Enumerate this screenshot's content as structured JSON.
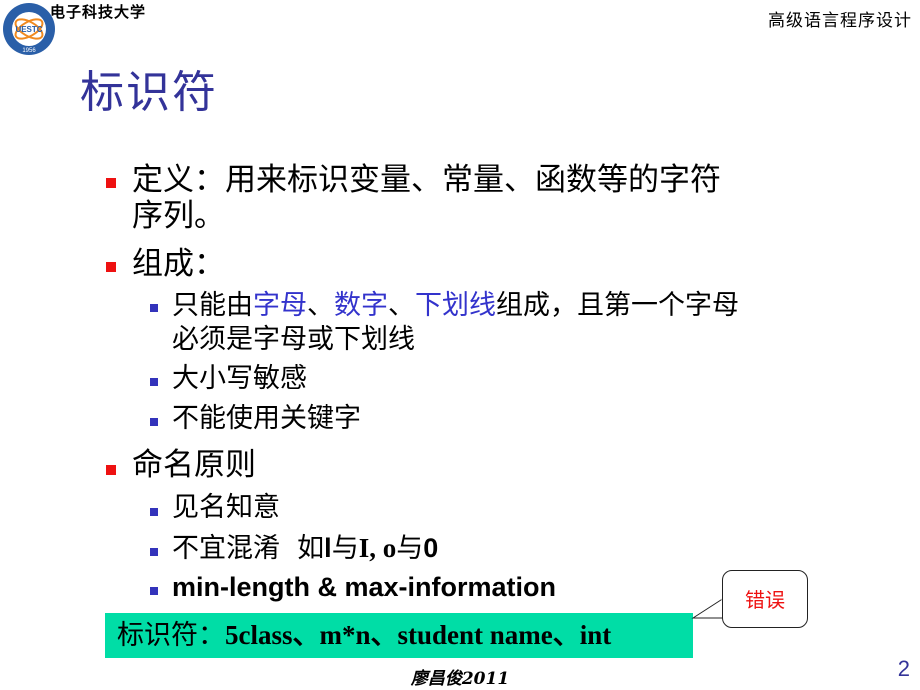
{
  "header": {
    "school_name": "电子科技大学",
    "logo_text": "UESTC",
    "logo_year": "1956",
    "course_title": "高级语言程序设计"
  },
  "slide": {
    "title": "标识符",
    "items": [
      {
        "level": 1,
        "text_line1": "定义：用来标识变量、常量、函数等的字符",
        "text_line2": "序列。"
      },
      {
        "level": 1,
        "text": "组成："
      },
      {
        "level": 2,
        "prefix": "只能由",
        "hl1": "字母",
        "sep1": "、",
        "hl2": "数字",
        "sep2": "、",
        "hl3": "下划线",
        "suffix": "组成，且第一个字母",
        "line2": "必须是字母或下划线"
      },
      {
        "level": 2,
        "text": "大小写敏感"
      },
      {
        "level": 2,
        "text": "不能使用关键字"
      },
      {
        "level": 1,
        "text": "命名原则"
      },
      {
        "level": 2,
        "text": "见名知意"
      },
      {
        "level": 2,
        "prefix": "不宜混淆  如",
        "c1": "l",
        "mid1": "与",
        "c2": "I, o",
        "mid2": "与",
        "c3": "0"
      },
      {
        "level": 2,
        "text": "min-length & max-information"
      }
    ],
    "example_box": {
      "label": "标识符：",
      "examples": "5class、m*n、student name、int"
    },
    "callout": {
      "text": "错误",
      "color": "#ee1111"
    },
    "colors": {
      "title": "#333399",
      "highlight": "#3333cc",
      "level1_bullet": "#ee1111",
      "level2_bullet": "#3333bb",
      "example_bg": "#00dda6"
    }
  },
  "footer": {
    "author": "廖昌俊2011",
    "page_number": "2"
  }
}
